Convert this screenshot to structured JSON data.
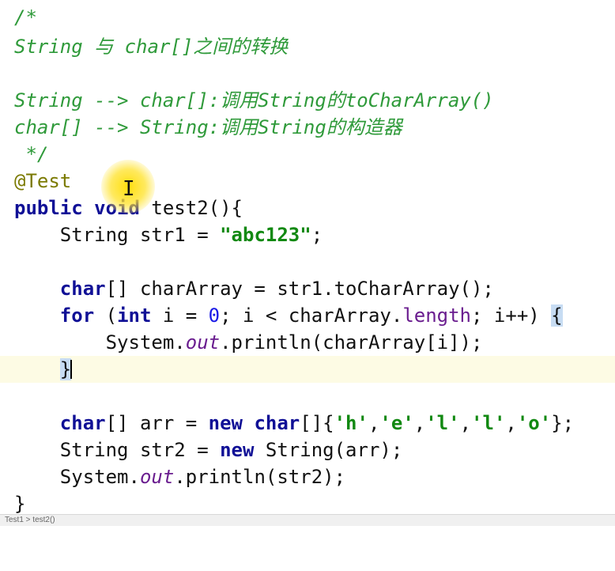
{
  "comment": {
    "open": "/*",
    "title": "String 与 char[]之间的转换",
    "line1": "String --> char[]:调用String的toCharArray()",
    "line2": "char[] --> String:调用String的构造器",
    "close": " */"
  },
  "annotation": "@Test",
  "method": {
    "kw_public": "public",
    "kw_void": "void",
    "signature": " test2(){"
  },
  "stmt_str1": {
    "type": "String str1 = ",
    "literal": "\"abc123\"",
    "end": ";"
  },
  "stmt_chararray": {
    "kw_char": "char",
    "rest": "[] charArray = str1.toCharArray();"
  },
  "stmt_for": {
    "kw_for": "for",
    "paren_open": " (",
    "kw_int": "int",
    "init": " i = ",
    "zero": "0",
    "cond": "; i < charArray.",
    "field_length": "length",
    "incr": "; i++) ",
    "brace": "{"
  },
  "stmt_println1": {
    "system": "System.",
    "out": "out",
    "call": ".println(charArray[i]);"
  },
  "close_brace": "}",
  "stmt_arr": {
    "kw_char": "char",
    "decl": "[] arr = ",
    "kw_new": "new",
    "sp": " ",
    "kw_char2": "char",
    "brackets": "[]{",
    "h": "'h'",
    "e": "'e'",
    "l1": "'l'",
    "l2": "'l'",
    "o": "'o'",
    "comma": ",",
    "end": "};"
  },
  "stmt_str2": {
    "decl": "String str2 = ",
    "kw_new": "new",
    "rest": " String(arr);"
  },
  "stmt_println2": {
    "system": "System.",
    "out": "out",
    "call": ".println(str2);"
  },
  "method_close": "}",
  "status": {
    "text": "Test1 > test2()"
  }
}
